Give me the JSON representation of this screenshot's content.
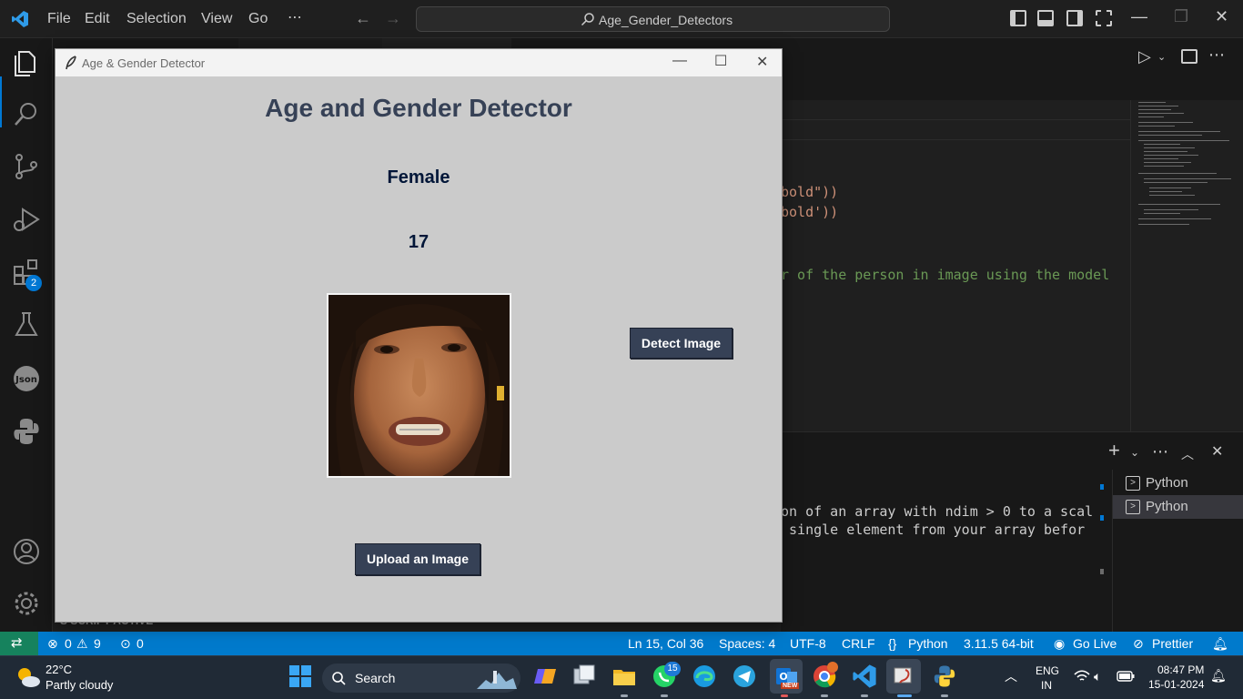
{
  "vscode": {
    "menu": [
      "File",
      "Edit",
      "Selection",
      "View",
      "Go",
      "⋯"
    ],
    "search_text": "Age_Gender_Detectors",
    "extensions_badge": "2",
    "code_fragments": [
      "bold\"))",
      "bold'))",
      "r of the person in image using the model"
    ],
    "terminal_lines": [
      "on of an array with ndim > 0 to a scal",
      " single element from your array befor"
    ],
    "terminals": [
      "Python",
      "Python"
    ],
    "bottom_peek": "S SCRIPT ACTIVE"
  },
  "statusbar": {
    "errors": "0",
    "warnings": "9",
    "ports": "0",
    "cursor": "Ln 15, Col 36",
    "spaces": "Spaces: 4",
    "encoding": "UTF-8",
    "eol": "CRLF",
    "language": "Python",
    "interpreter": "3.11.5 64-bit",
    "golive": "Go Live",
    "prettier": "Prettier"
  },
  "taskbar": {
    "temperature": "22°C",
    "weather": "Partly cloudy",
    "search_label": "Search",
    "whatsapp_badge": "15",
    "outlook_badge": "NEW",
    "lang_top": "ENG",
    "lang_bottom": "IN",
    "time": "08:47 PM",
    "date": "15-01-2024"
  },
  "app": {
    "window_title": "Age & Gender Detector",
    "heading": "Age and Gender Detector",
    "gender_result": "Female",
    "age_result": "17",
    "detect_button": "Detect Image",
    "upload_button": "Upload an Image"
  },
  "colors": {
    "button_bg": "#364156",
    "heading_color": "#364156",
    "result_color": "#011638",
    "window_bg": "#cbcbcb",
    "statusbar_bg": "#007acc"
  }
}
